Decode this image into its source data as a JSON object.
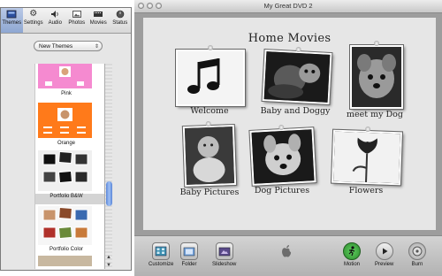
{
  "drawer": {
    "tabs": [
      {
        "label": "Themes",
        "icon": "themes-icon",
        "active": true
      },
      {
        "label": "Settings",
        "icon": "gear-icon",
        "active": false
      },
      {
        "label": "Audio",
        "icon": "speaker-icon",
        "active": false
      },
      {
        "label": "Photos",
        "icon": "photos-icon",
        "active": false
      },
      {
        "label": "Movies",
        "icon": "film-icon",
        "active": false
      },
      {
        "label": "Status",
        "icon": "status-icon",
        "active": false
      }
    ],
    "theme_select": {
      "value": "New Themes"
    },
    "themes": [
      {
        "label": "Pink"
      },
      {
        "label": "Orange"
      },
      {
        "label": "Portfolio B&W",
        "selected": true
      },
      {
        "label": "Portfolio Color"
      }
    ]
  },
  "window": {
    "title": "My Great DVD 2",
    "menu_title": "Home Movies",
    "buttons": [
      {
        "label": "Welcome",
        "icon": "music-notes-icon"
      },
      {
        "label": "Baby and Doggy",
        "icon": "photo-baby-dog"
      },
      {
        "label": "meet my Dog",
        "icon": "photo-dog"
      },
      {
        "label": "Baby Pictures",
        "icon": "photo-baby"
      },
      {
        "label": "Dog Pictures",
        "icon": "photo-dog-closeup"
      },
      {
        "label": "Flowers",
        "icon": "photo-flower"
      }
    ]
  },
  "toolbar": {
    "customize": "Customize",
    "folder": "Folder",
    "slideshow": "Slideshow",
    "motion": "Motion",
    "preview": "Preview",
    "burn": "Burn"
  },
  "colors": {
    "pink_theme": "#f58ad0",
    "orange_theme": "#ff7a1a",
    "motion_green": "#2e8b2e",
    "scroll_blue": "#5a86d8"
  }
}
